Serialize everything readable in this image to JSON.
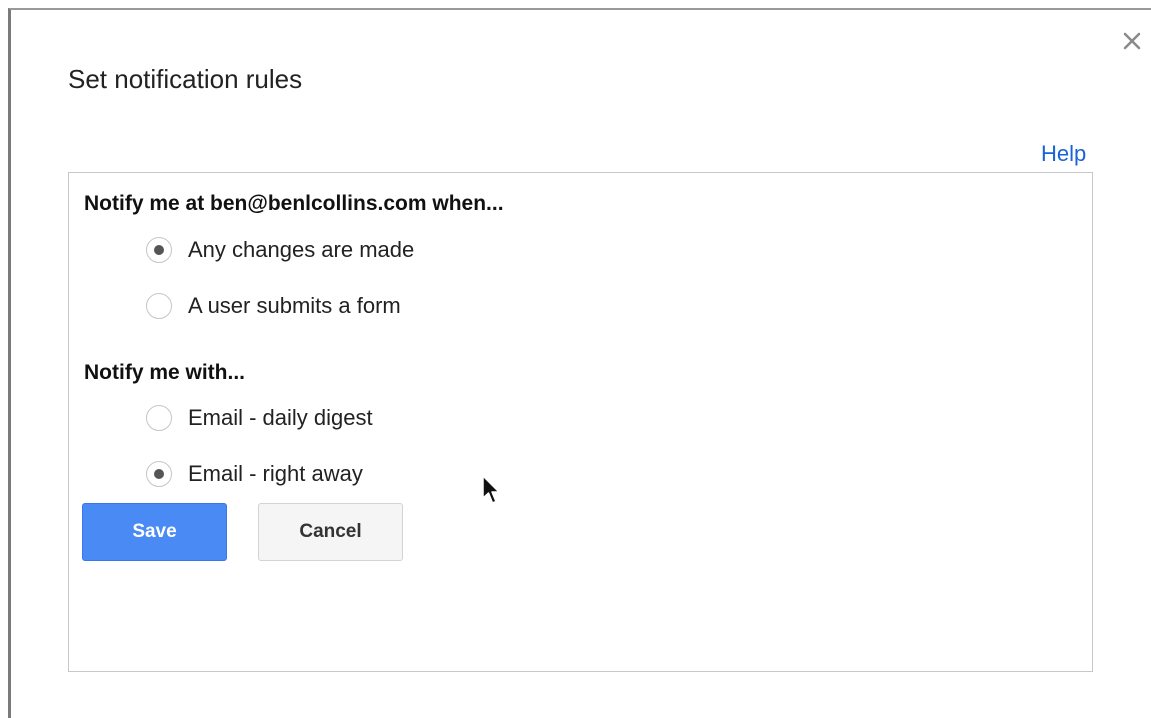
{
  "dialog": {
    "title": "Set notification rules",
    "help_link": "Help",
    "close_icon": "close-icon"
  },
  "when_section": {
    "heading": "Notify me at ben@benlcollins.com when...",
    "options": [
      {
        "label": "Any changes are made",
        "selected": true
      },
      {
        "label": "A user submits a form",
        "selected": false
      }
    ]
  },
  "with_section": {
    "heading": "Notify me with...",
    "options": [
      {
        "label": "Email - daily digest",
        "selected": false
      },
      {
        "label": "Email - right away",
        "selected": true
      }
    ]
  },
  "buttons": {
    "save_label": "Save",
    "cancel_label": "Cancel"
  },
  "colors": {
    "accent": "#4a8af4",
    "link": "#1a62d8"
  }
}
